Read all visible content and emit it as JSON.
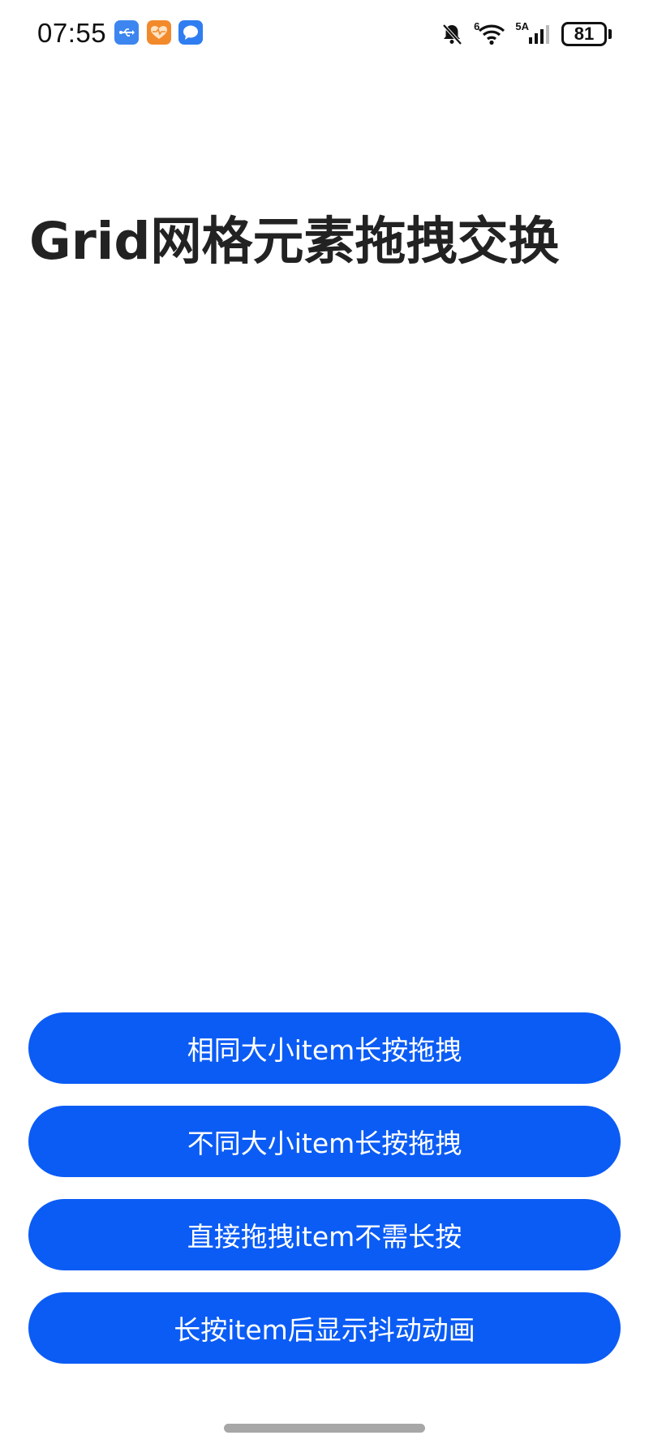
{
  "status_bar": {
    "time": "07:55",
    "notification_icons": [
      "usb-icon",
      "health-app-icon",
      "message-app-icon"
    ],
    "network_label_wifi": "6",
    "network_label_cellular": "5A",
    "battery_level": "81",
    "icons": [
      "mute-bell-icon",
      "wifi-icon",
      "cellular-signal-icon",
      "battery-icon"
    ]
  },
  "page": {
    "title": "Grid网格元素拖拽交换"
  },
  "buttons": [
    {
      "label": "相同大小item长按拖拽"
    },
    {
      "label": "不同大小item长按拖拽"
    },
    {
      "label": "直接拖拽item不需长按"
    },
    {
      "label": "长按item后显示抖动动画"
    }
  ],
  "colors": {
    "button_background": "#0b5cf5",
    "button_text": "#ffffff",
    "title_text": "#222222",
    "page_background": "#ffffff"
  }
}
